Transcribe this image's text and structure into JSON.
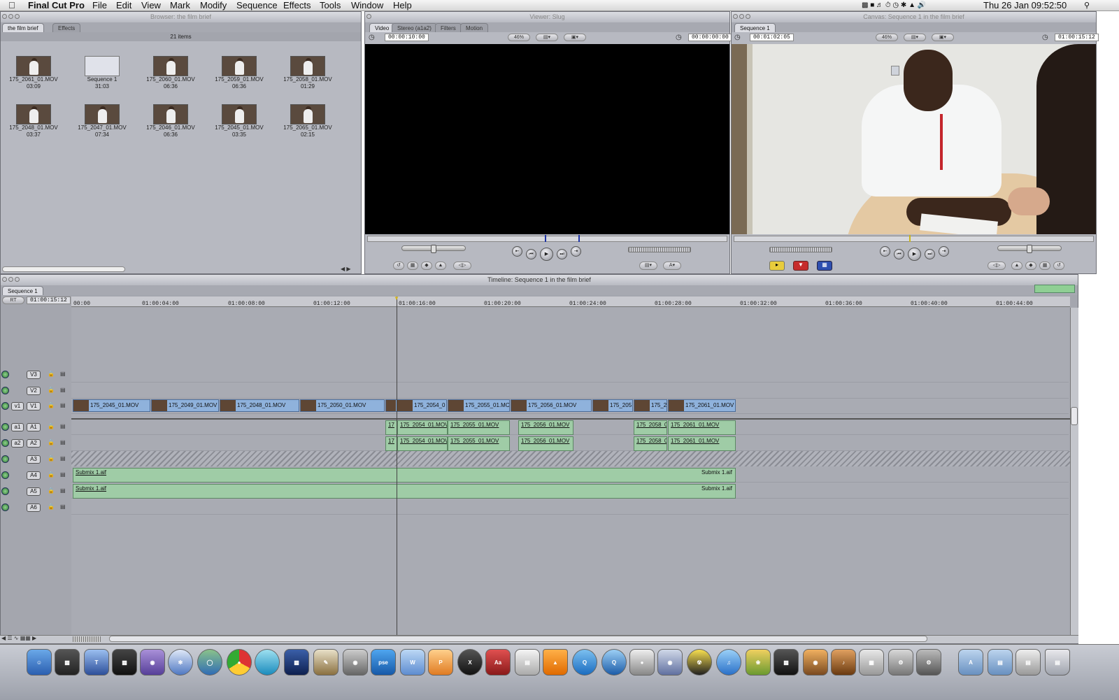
{
  "menubar": {
    "app_name": "Final Cut Pro",
    "menus": [
      "File",
      "Edit",
      "View",
      "Mark",
      "Modify",
      "Sequence",
      "Effects",
      "Tools",
      "Window",
      "Help"
    ],
    "clock": "Thu 26 Jan  09:52:50"
  },
  "browser": {
    "title": "Browser: the film brief",
    "tabs": [
      "the film brief",
      "Effects"
    ],
    "count": "21 items",
    "clips": [
      {
        "name": "175_2061_01.MOV",
        "duration": "03:09"
      },
      {
        "name": "Sequence 1",
        "duration": "31:03"
      },
      {
        "name": "175_2060_01.MOV",
        "duration": "06:36"
      },
      {
        "name": "175_2059_01.MOV",
        "duration": "06:36"
      },
      {
        "name": "175_2058_01.MOV",
        "duration": "01:29"
      },
      {
        "name": "175_2048_01.MOV",
        "duration": "03:37"
      },
      {
        "name": "175_2047_01.MOV",
        "duration": "07:34"
      },
      {
        "name": "175_2046_01.MOV",
        "duration": "06:36"
      },
      {
        "name": "175_2045_01.MOV",
        "duration": "03:35"
      },
      {
        "name": "175_2065_01.MOV",
        "duration": "02:15"
      }
    ]
  },
  "viewer": {
    "title": "Viewer: Slug",
    "tabs": [
      "Video",
      "Stereo (a1a2)",
      "Filters",
      "Motion"
    ],
    "duration_tc": "00:00:10:00",
    "zoom": "46%",
    "current_tc": "00:00:00:00"
  },
  "canvas": {
    "title": "Canvas: Sequence 1 in the film brief",
    "tab": "Sequence 1",
    "duration_tc": "00:01:02:05",
    "zoom": "46%",
    "current_tc": "01:00:15:12"
  },
  "timeline": {
    "title": "Timeline: Sequence 1 in the film brief",
    "tab": "Sequence 1",
    "rt": "RT",
    "current_tc": "01:00:15:12",
    "ruler": [
      "00:00",
      "01:00:04:00",
      "01:00:08:00",
      "01:00:12:00",
      "01:00:16:00",
      "01:00:20:00",
      "01:00:24:00",
      "01:00:28:00",
      "01:00:32:00",
      "01:00:36:00",
      "01:00:40:00",
      "01:00:44:00"
    ],
    "tracks": {
      "v3": "V3",
      "v2": "V2",
      "v1_src": "v1",
      "v1": "V1",
      "a1_src": "a1",
      "a1": "A1",
      "a2_src": "a2",
      "a2": "A2",
      "a3": "A3",
      "a4": "A4",
      "a5": "A5",
      "a6": "A6"
    },
    "video_clips": [
      "175_2045_01.MOV",
      "175_2049_01.MOV",
      "175_2048_01.MOV",
      "175_2050_01.MOV",
      "175_2054_0",
      "175_2055_01.MC",
      "175_2056_01.MOV",
      "175_205",
      "175_2",
      "175_2061_01.MOV"
    ],
    "audio_clips": {
      "a1": [
        "17",
        "175_2054_01.MOV",
        "175_2055_01.MOV",
        "175_2056_01.MOV",
        "175_2058_0",
        "175_2061_01.MOV"
      ],
      "a2": [
        "17",
        "175_2054_01.MOV",
        "175_2055_01.MOV",
        "175_2056_01.MOV",
        "175_2058_0",
        "175_2061_01.MOV"
      ],
      "submix": "Submix 1.aif"
    }
  },
  "dock": {
    "apps": [
      "Finder",
      "Final Cut Pro",
      "Text",
      "Motion",
      "Color",
      "Safari",
      "Globe",
      "Chrome",
      "Sphere",
      "iMovie",
      "Draw",
      "Camera",
      "pse",
      "Wacom",
      "Paint",
      "X",
      "Dictionary",
      "Preview",
      "VLC",
      "Q",
      "QuickTime",
      "DVD",
      "Photo",
      "Burn",
      "iTunes",
      "Pineapple",
      "Clapper",
      "iPhoto",
      "GarageBand",
      "Calculator",
      "Prefs",
      "System",
      "Apps",
      "Docs",
      "Downloads",
      "Trash"
    ],
    "pse_label": "pse",
    "dict_label": "Aa"
  }
}
